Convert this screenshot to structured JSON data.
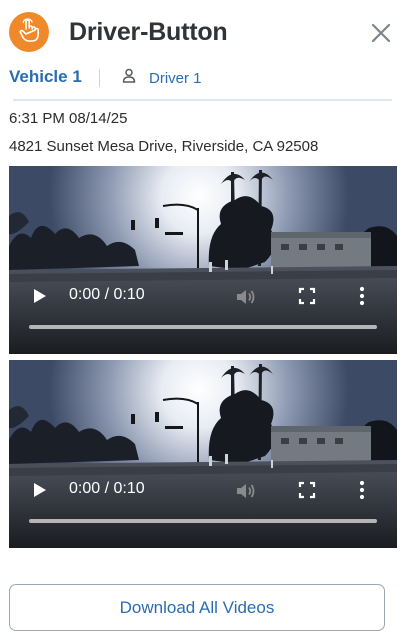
{
  "header": {
    "title": "Driver-Button",
    "badge_icon": "hand-pointer-icon",
    "close_icon": "close-icon",
    "accent_color": "#f0892a"
  },
  "tabs": {
    "vehicle_label": "Vehicle 1",
    "driver_label": "Driver 1",
    "driver_icon": "person-icon"
  },
  "event": {
    "timestamp": "6:31 PM 08/14/25",
    "address": "4821 Sunset Mesa Drive, Riverside, CA 92508"
  },
  "videos": [
    {
      "time_display": "0:00 / 0:10"
    },
    {
      "time_display": "0:00 / 0:10"
    }
  ],
  "download_label": "Download All Videos"
}
